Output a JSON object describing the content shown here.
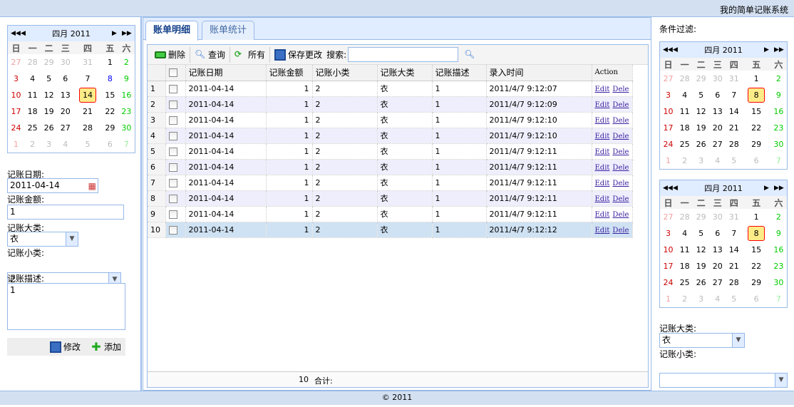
{
  "header": {
    "title": "我的简单记账系统"
  },
  "footer": {
    "text": "© 2011"
  },
  "weekdays": [
    "日",
    "一",
    "二",
    "三",
    "四",
    "五",
    "六"
  ],
  "calendars": [
    {
      "title": "四月 2011",
      "selected": "14"
    },
    {
      "title": "四月 2011",
      "selected": "8"
    },
    {
      "title": "四月 2011",
      "selected": "8"
    }
  ],
  "form": {
    "date_label": "记账日期:",
    "date_value": "2011-04-14",
    "amount_label": "记账金额:",
    "amount_value": "1",
    "category_label": "记账大类:",
    "category_value": "衣",
    "subcategory_label": "记账小类:",
    "subcategory_value": "2",
    "desc_label": "记账描述:",
    "desc_value": "1",
    "modify": "修改",
    "add": "添加"
  },
  "tabs": [
    "账单明细",
    "账单统计"
  ],
  "toolbar": {
    "delete": "删除",
    "query": "查询",
    "all": "所有",
    "save": "保存更改",
    "search_label": "搜索:",
    "search_value": ""
  },
  "columns": [
    "记账日期",
    "记账金额",
    "记账小类",
    "记账大类",
    "记账描述",
    "录入时间",
    "Action"
  ],
  "rows": [
    {
      "n": "1",
      "date": "2011-04-14",
      "amount": "1",
      "sub": "2",
      "cat": "衣",
      "desc": "1",
      "time": "2011/4/7 9:12:07"
    },
    {
      "n": "2",
      "date": "2011-04-14",
      "amount": "1",
      "sub": "2",
      "cat": "衣",
      "desc": "1",
      "time": "2011/4/7 9:12:09"
    },
    {
      "n": "3",
      "date": "2011-04-14",
      "amount": "1",
      "sub": "2",
      "cat": "衣",
      "desc": "1",
      "time": "2011/4/7 9:12:10"
    },
    {
      "n": "4",
      "date": "2011-04-14",
      "amount": "1",
      "sub": "2",
      "cat": "衣",
      "desc": "1",
      "time": "2011/4/7 9:12:10"
    },
    {
      "n": "5",
      "date": "2011-04-14",
      "amount": "1",
      "sub": "2",
      "cat": "衣",
      "desc": "1",
      "time": "2011/4/7 9:12:11"
    },
    {
      "n": "6",
      "date": "2011-04-14",
      "amount": "1",
      "sub": "2",
      "cat": "衣",
      "desc": "1",
      "time": "2011/4/7 9:12:11"
    },
    {
      "n": "7",
      "date": "2011-04-14",
      "amount": "1",
      "sub": "2",
      "cat": "衣",
      "desc": "1",
      "time": "2011/4/7 9:12:11"
    },
    {
      "n": "8",
      "date": "2011-04-14",
      "amount": "1",
      "sub": "2",
      "cat": "衣",
      "desc": "1",
      "time": "2011/4/7 9:12:11"
    },
    {
      "n": "9",
      "date": "2011-04-14",
      "amount": "1",
      "sub": "2",
      "cat": "衣",
      "desc": "1",
      "time": "2011/4/7 9:12:11"
    },
    {
      "n": "10",
      "date": "2011-04-14",
      "amount": "1",
      "sub": "2",
      "cat": "衣",
      "desc": "1",
      "time": "2011/4/7 9:12:12"
    }
  ],
  "actions": {
    "edit": "Edit",
    "delete": "Dele"
  },
  "summary": {
    "amount": "10",
    "label": "合计:"
  },
  "filter": {
    "title": "条件过滤:",
    "category_label": "记账大类:",
    "category_value": "衣",
    "subcategory_label": "记账小类:",
    "subcategory_value": ""
  },
  "colors": {
    "accent": "#99bbe8",
    "header_bg": "#d3e0f1"
  }
}
